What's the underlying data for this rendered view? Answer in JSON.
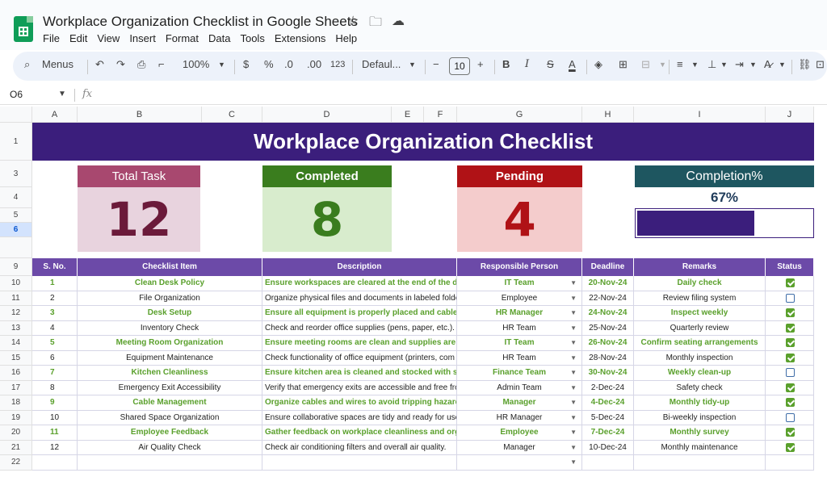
{
  "doc": {
    "title": "Workplace Organization Checklist in Google Sheets"
  },
  "menu": [
    "File",
    "Edit",
    "View",
    "Insert",
    "Format",
    "Data",
    "Tools",
    "Extensions",
    "Help"
  ],
  "toolbar": {
    "search_label": "Menus",
    "zoom": "100%",
    "currency": "$",
    "percent": "%",
    "dec_decrease": ".0",
    "dec_increase": ".00",
    "format_123": "123",
    "font": "Defaul...",
    "font_size": "10",
    "minus": "−",
    "plus": "+",
    "bold": "B",
    "italic": "I",
    "strike": "S",
    "text_color": "A"
  },
  "formula_bar": {
    "cell_ref": "O6",
    "fx": "fx"
  },
  "columns": [
    "A",
    "B",
    "C",
    "D",
    "E",
    "F",
    "G",
    "H",
    "I",
    "J"
  ],
  "rows": [
    "1",
    "3",
    "4",
    "5",
    "6",
    "9",
    "10",
    "11",
    "12",
    "13",
    "14",
    "15",
    "16",
    "17",
    "18",
    "19",
    "20",
    "21",
    "22"
  ],
  "sheet": {
    "banner": "Workplace Organization Checklist",
    "kpi": {
      "total_label": "Total Task",
      "total_value": "12",
      "completed_label": "Completed",
      "completed_value": "8",
      "pending_label": "Pending",
      "pending_value": "4",
      "completion_label": "Completion%",
      "completion_value": "67%",
      "completion_fraction": 0.67
    },
    "colors": {
      "banner": "#3b1e7c",
      "header": "#6c4aa8",
      "total_head": "#a8486f",
      "total_bg": "#e8d3de",
      "total_text": "#6b1a3a",
      "completed_head": "#3a7d1e",
      "completed_bg": "#d8eccd",
      "completed_text": "#3a7d1e",
      "pending_head": "#b01216",
      "pending_bg": "#f4cccc",
      "pending_text": "#b01216",
      "completion_head": "#1e5660"
    },
    "headers": [
      "S. No.",
      "Checklist Item",
      "Description",
      "Responsible Person",
      "Deadline",
      "Remarks",
      "Status"
    ],
    "tasks": [
      {
        "sno": "1",
        "item": "Clean Desk Policy",
        "desc": "Ensure workspaces are cleared at the end of the day.",
        "person": "IT Team",
        "deadline": "20-Nov-24",
        "remarks": "Daily check",
        "done": true
      },
      {
        "sno": "2",
        "item": "File Organization",
        "desc": "Organize physical files and documents in labeled folders.",
        "person": "Employee",
        "deadline": "22-Nov-24",
        "remarks": "Review filing system",
        "done": false
      },
      {
        "sno": "3",
        "item": "Desk Setup",
        "desc": "Ensure all equipment is properly placed and cables are",
        "person": "HR Manager",
        "deadline": "24-Nov-24",
        "remarks": "Inspect weekly",
        "done": true
      },
      {
        "sno": "4",
        "item": "Inventory Check",
        "desc": "Check and reorder office supplies (pens, paper, etc.).",
        "person": "HR Team",
        "deadline": "25-Nov-24",
        "remarks": "Quarterly review",
        "done": true
      },
      {
        "sno": "5",
        "item": "Meeting Room Organization",
        "desc": "Ensure meeting rooms are clean and supplies are stocked",
        "person": "IT Team",
        "deadline": "26-Nov-24",
        "remarks": "Confirm seating arrangements",
        "done": true
      },
      {
        "sno": "6",
        "item": "Equipment Maintenance",
        "desc": "Check functionality of office equipment (printers, com",
        "person": "HR Team",
        "deadline": "28-Nov-24",
        "remarks": "Monthly inspection",
        "done": true
      },
      {
        "sno": "7",
        "item": "Kitchen Cleanliness",
        "desc": "Ensure kitchen area is cleaned and stocked with supplies.",
        "person": "Finance Team",
        "deadline": "30-Nov-24",
        "remarks": "Weekly clean-up",
        "done": false
      },
      {
        "sno": "8",
        "item": "Emergency Exit Accessibility",
        "desc": "Verify that emergency exits are accessible and free fro",
        "person": "Admin Team",
        "deadline": "2-Dec-24",
        "remarks": "Safety check",
        "done": true
      },
      {
        "sno": "9",
        "item": "Cable Management",
        "desc": "Organize cables and wires to avoid tripping hazards.",
        "person": "Manager",
        "deadline": "4-Dec-24",
        "remarks": "Monthly tidy-up",
        "done": true
      },
      {
        "sno": "10",
        "item": "Shared Space Organization",
        "desc": "Ensure collaborative spaces are tidy and ready for use.",
        "person": "HR Manager",
        "deadline": "5-Dec-24",
        "remarks": "Bi-weekly inspection",
        "done": false
      },
      {
        "sno": "11",
        "item": "Employee Feedback",
        "desc": "Gather feedback on workplace cleanliness and organiz",
        "person": "Employee",
        "deadline": "7-Dec-24",
        "remarks": "Monthly survey",
        "done": true
      },
      {
        "sno": "12",
        "item": "Air Quality Check",
        "desc": "Check air conditioning filters and overall air quality.",
        "person": "Manager",
        "deadline": "10-Dec-24",
        "remarks": "Monthly maintenance",
        "done": true
      }
    ]
  }
}
